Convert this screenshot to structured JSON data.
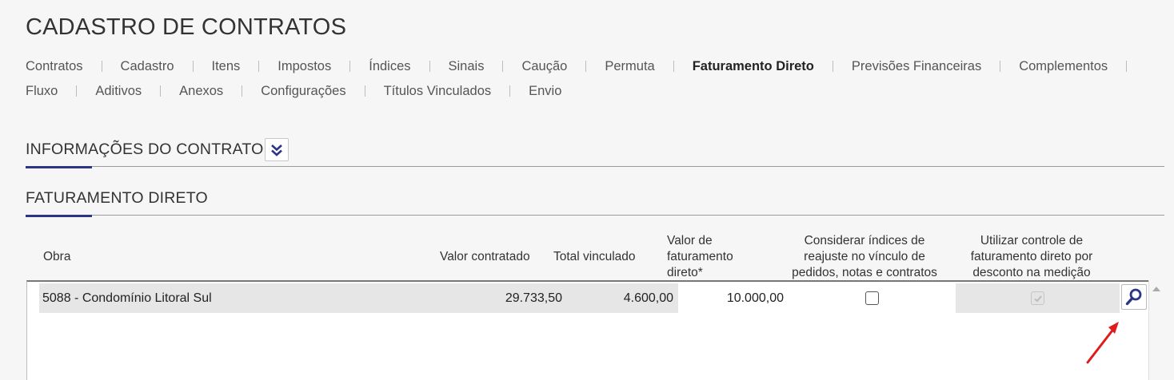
{
  "page_title": "CADASTRO DE CONTRATOS",
  "tabs_row1": [
    "Contratos",
    "Cadastro",
    "Itens",
    "Impostos",
    "Índices",
    "Sinais",
    "Caução",
    "Permuta",
    "Faturamento Direto",
    "Previsões Financeiras",
    "Complementos"
  ],
  "tabs_row2": [
    "Fluxo",
    "Aditivos",
    "Anexos",
    "Configurações",
    "Títulos Vinculados",
    "Envio"
  ],
  "active_tab": "Faturamento Direto",
  "sections": {
    "info": "INFORMAÇÕES DO CONTRATO",
    "faturamento": "FATURAMENTO DIRETO"
  },
  "columns": {
    "obra": "Obra",
    "valor_contratado": "Valor contratado",
    "total_vinculado": "Total vinculado",
    "valor_faturamento": [
      "Valor de",
      "faturamento",
      "direto*"
    ],
    "considerar_indices": [
      "Considerar índices de",
      "reajuste no vínculo de",
      "pedidos, notas e contratos"
    ],
    "utilizar_controle": [
      "Utilizar controle de",
      "faturamento direto por",
      "desconto na medição"
    ]
  },
  "rows": [
    {
      "obra": "5088 - Condomínio Litoral Sul",
      "valor_contratado": "29.733,50",
      "total_vinculado": "4.600,00",
      "valor_faturamento": "10.000,00",
      "considerar_indices_checked": false,
      "utilizar_controle_checked": true,
      "utilizar_controle_disabled": true
    }
  ],
  "icons": {
    "expand": "double-chevron-down-icon",
    "search": "magnifier-icon",
    "annotation": "red-arrow-annotation"
  },
  "colors": {
    "accent": "#2b3584",
    "annotation_arrow": "#e01b1b"
  }
}
